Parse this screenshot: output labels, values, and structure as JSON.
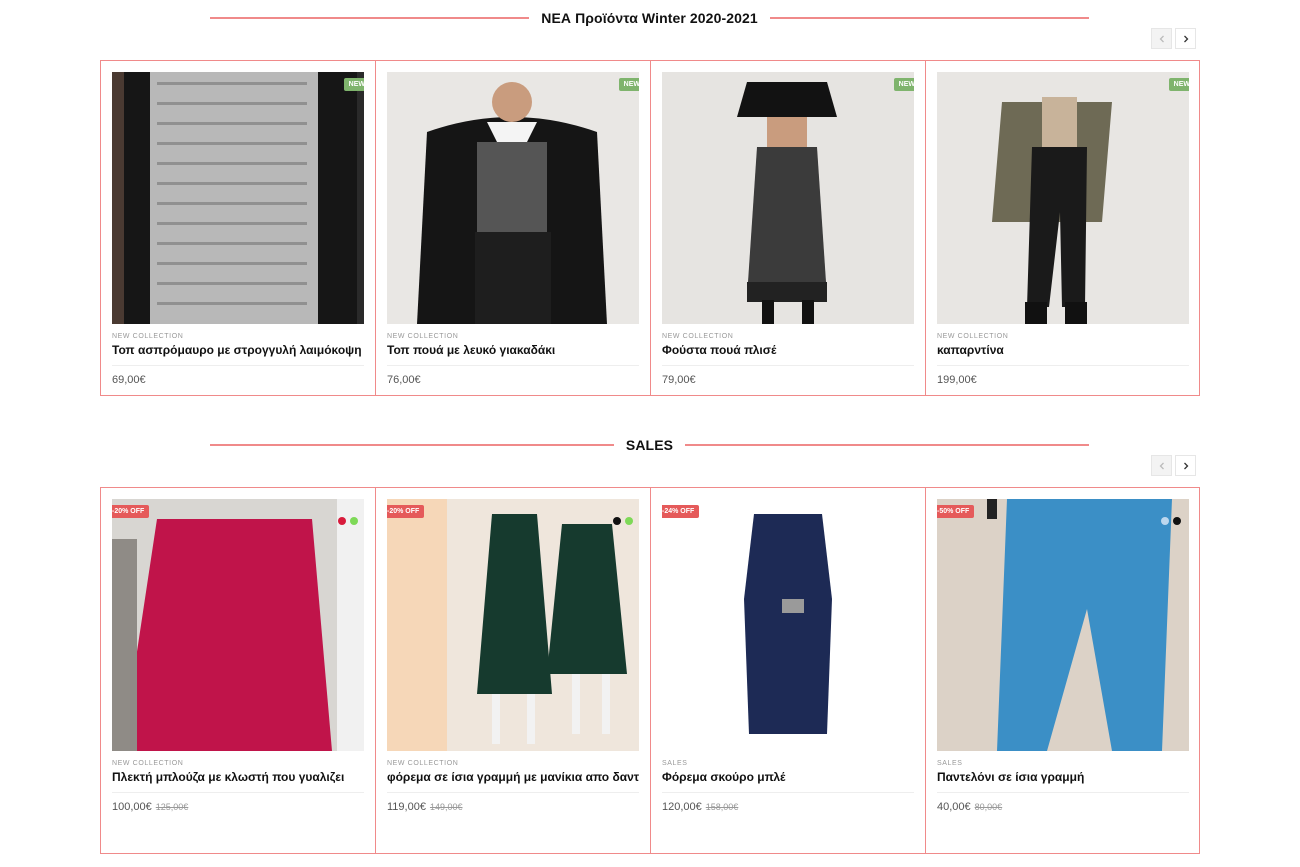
{
  "sections": [
    {
      "title": "ΝΕΑ Προϊόντα Winter 2020-2021",
      "products": [
        {
          "badge": "NEW",
          "category": "NEW COLLECTION",
          "name": "Τοπ ασπρόμαυρο με στρογγυλή λαιμόκοψη",
          "price": "69,00€"
        },
        {
          "badge": "NEW",
          "category": "NEW COLLECTION",
          "name": "Τοπ πουά με λευκό γιακαδάκι",
          "price": "76,00€"
        },
        {
          "badge": "NEW",
          "category": "NEW COLLECTION",
          "name": "Φούστα πουά πλισέ",
          "price": "79,00€"
        },
        {
          "badge": "NEW",
          "category": "NEW COLLECTION",
          "name": "καπαρντίνα",
          "price": "199,00€"
        }
      ]
    },
    {
      "title": "SALES",
      "products": [
        {
          "badge": "-20% OFF",
          "category": "NEW COLLECTION",
          "name": "Πλεκτή μπλούζα με κλωστή που γυαλιζει",
          "price": "100,00€",
          "old_price": "125,00€",
          "swatches": [
            "#d81b3c",
            "#7ed957"
          ]
        },
        {
          "badge": "-20% OFF",
          "category": "NEW COLLECTION",
          "name": "φόρεμα σε ίσια γραμμή με μανίκια απο δαντέλα",
          "price": "119,00€",
          "old_price": "149,00€",
          "swatches": [
            "#111111",
            "#7ed957"
          ]
        },
        {
          "badge": "-24% OFF",
          "category": "SALES",
          "name": "Φόρεμα σκούρο μπλέ",
          "price": "120,00€",
          "old_price": "158,00€",
          "swatches": []
        },
        {
          "badge": "-50% OFF",
          "category": "SALES",
          "name": "Παντελόνι σε ίσια γραμμή",
          "price": "40,00€",
          "old_price": "80,00€",
          "swatches": [
            "#bcd7ee",
            "#111111"
          ]
        }
      ]
    }
  ],
  "colors": {
    "accent_line": "#f08a8a",
    "new_badge": "#7fb46d",
    "off_badge": "#e55a5a"
  },
  "icons": {
    "prev": "chevron-left-icon",
    "next": "chevron-right-icon"
  }
}
